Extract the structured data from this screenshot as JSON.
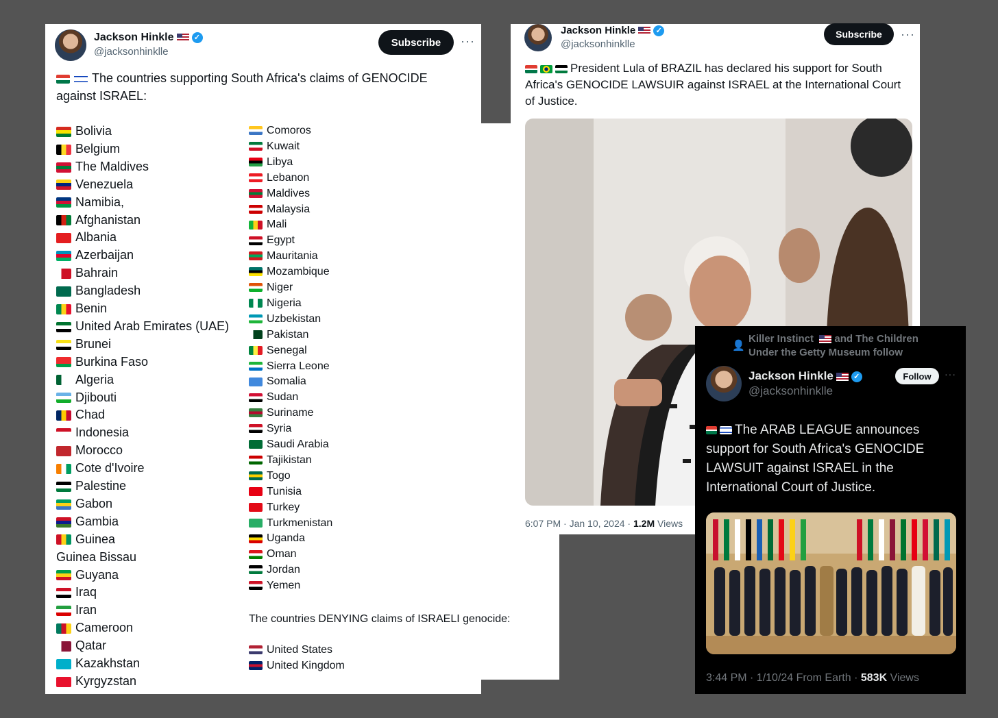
{
  "tweet1": {
    "user": {
      "name": "Jackson Hinkle",
      "handle": "@jacksonhinklle"
    },
    "subscribe_label": "Subscribe",
    "more_label": "···",
    "text_line1": "The countries supporting South Africa's claims of GENOCIDE",
    "text_line2": "against ISRAEL:",
    "col1": [
      {
        "name": "Bolivia",
        "colors": [
          "#d52b1e",
          "#f9e300",
          "#007934"
        ]
      },
      {
        "name": "Belgium",
        "colors": [
          "#000000",
          "#fdda24",
          "#ef3340"
        ],
        "dir": "v"
      },
      {
        "name": "The Maldives",
        "colors": [
          "#d21034",
          "#007e3a",
          "#d21034"
        ]
      },
      {
        "name": "Venezuela",
        "colors": [
          "#fcd116",
          "#00247d",
          "#cf142b"
        ]
      },
      {
        "name": "Namibia,",
        "colors": [
          "#003580",
          "#d21034",
          "#009543"
        ]
      },
      {
        "name": "Afghanistan",
        "colors": [
          "#000000",
          "#d32011",
          "#007a36"
        ],
        "dir": "v"
      },
      {
        "name": "Albania",
        "colors": [
          "#e41e20",
          "#e41e20",
          "#e41e20"
        ]
      },
      {
        "name": "Azerbaijan",
        "colors": [
          "#0092bc",
          "#e4002b",
          "#00af66"
        ]
      },
      {
        "name": "Bahrain",
        "colors": [
          "#ffffff",
          "#ce1126",
          "#ce1126"
        ],
        "dir": "v"
      },
      {
        "name": "Bangladesh",
        "colors": [
          "#006a4e",
          "#006a4e",
          "#006a4e"
        ]
      },
      {
        "name": "Benin",
        "colors": [
          "#008751",
          "#fcd116",
          "#e8112d"
        ],
        "dir": "v"
      },
      {
        "name": "United Arab Emirates (UAE)",
        "colors": [
          "#00732f",
          "#ffffff",
          "#000000"
        ]
      },
      {
        "name": "Brunei",
        "colors": [
          "#f7e017",
          "#ffffff",
          "#000000"
        ]
      },
      {
        "name": "Burkina Faso",
        "colors": [
          "#ef2b2d",
          "#ef2b2d",
          "#009e49"
        ]
      },
      {
        "name": "Algeria",
        "colors": [
          "#006233",
          "#ffffff",
          "#ffffff"
        ],
        "dir": "v"
      },
      {
        "name": "Djibouti",
        "colors": [
          "#6ab2e7",
          "#ffffff",
          "#12ad2b"
        ]
      },
      {
        "name": "Chad",
        "colors": [
          "#002664",
          "#fecb00",
          "#c60c30"
        ],
        "dir": "v"
      },
      {
        "name": "Indonesia",
        "colors": [
          "#ce1126",
          "#ffffff",
          "#ffffff"
        ]
      },
      {
        "name": "Morocco",
        "colors": [
          "#c1272d",
          "#c1272d",
          "#c1272d"
        ]
      },
      {
        "name": "Cote d'Ivoire",
        "colors": [
          "#f77f00",
          "#ffffff",
          "#009e60"
        ],
        "dir": "v"
      },
      {
        "name": "Palestine",
        "colors": [
          "#000000",
          "#ffffff",
          "#007a3d"
        ]
      },
      {
        "name": "Gabon",
        "colors": [
          "#009e60",
          "#fcd116",
          "#3a75c4"
        ]
      },
      {
        "name": "Gambia",
        "colors": [
          "#ce1126",
          "#0c1c8c",
          "#3a7728"
        ]
      },
      {
        "name": "Guinea",
        "colors": [
          "#ce1126",
          "#fcd116",
          "#009460"
        ],
        "dir": "v"
      },
      {
        "name": "Guinea Bissau",
        "noflag": true
      },
      {
        "name": "Guyana",
        "colors": [
          "#009e49",
          "#fcd116",
          "#ce1126"
        ]
      },
      {
        "name": "Iraq",
        "colors": [
          "#ce1126",
          "#ffffff",
          "#000000"
        ]
      },
      {
        "name": "Iran",
        "colors": [
          "#239f40",
          "#ffffff",
          "#da0000"
        ]
      },
      {
        "name": "Cameroon",
        "colors": [
          "#007a5e",
          "#ce1126",
          "#fcd116"
        ],
        "dir": "v"
      },
      {
        "name": "Qatar",
        "colors": [
          "#ffffff",
          "#8a1538",
          "#8a1538"
        ],
        "dir": "v"
      },
      {
        "name": "Kazakhstan",
        "colors": [
          "#00afca",
          "#00afca",
          "#00afca"
        ]
      },
      {
        "name": "Kyrgyzstan",
        "colors": [
          "#e8112d",
          "#e8112d",
          "#e8112d"
        ]
      }
    ],
    "col2": [
      {
        "name": "Comoros",
        "colors": [
          "#ffc61e",
          "#ffffff",
          "#3a75c4"
        ]
      },
      {
        "name": "Kuwait",
        "colors": [
          "#007a3d",
          "#ffffff",
          "#ce1126"
        ]
      },
      {
        "name": "Libya",
        "colors": [
          "#e70013",
          "#000000",
          "#239e46"
        ]
      },
      {
        "name": "Lebanon",
        "colors": [
          "#ed1c24",
          "#ffffff",
          "#ed1c24"
        ]
      },
      {
        "name": "Maldives",
        "colors": [
          "#d21034",
          "#007e3a",
          "#d21034"
        ]
      },
      {
        "name": "Malaysia",
        "colors": [
          "#cc0001",
          "#ffffff",
          "#cc0001"
        ]
      },
      {
        "name": "Mali",
        "colors": [
          "#14b53a",
          "#fcd116",
          "#ce1126"
        ],
        "dir": "v"
      },
      {
        "name": "Egypt",
        "colors": [
          "#ce1126",
          "#ffffff",
          "#000000"
        ]
      },
      {
        "name": "Mauritania",
        "colors": [
          "#d01c1f",
          "#00a95c",
          "#d01c1f"
        ]
      },
      {
        "name": "Mozambique",
        "colors": [
          "#007168",
          "#000000",
          "#fce100"
        ]
      },
      {
        "name": "Niger",
        "colors": [
          "#e05206",
          "#ffffff",
          "#0db02b"
        ]
      },
      {
        "name": "Nigeria",
        "colors": [
          "#008751",
          "#ffffff",
          "#008751"
        ],
        "dir": "v"
      },
      {
        "name": "Uzbekistan",
        "colors": [
          "#0099b5",
          "#ffffff",
          "#1eb53a"
        ]
      },
      {
        "name": "Pakistan",
        "colors": [
          "#ffffff",
          "#01411c",
          "#01411c"
        ],
        "dir": "v"
      },
      {
        "name": "Senegal",
        "colors": [
          "#00853f",
          "#fdef42",
          "#e31b23"
        ],
        "dir": "v"
      },
      {
        "name": "Sierra Leone",
        "colors": [
          "#1eb53a",
          "#ffffff",
          "#0072c6"
        ]
      },
      {
        "name": "Somalia",
        "colors": [
          "#4189dd",
          "#4189dd",
          "#4189dd"
        ]
      },
      {
        "name": "Sudan",
        "colors": [
          "#d21034",
          "#ffffff",
          "#000000"
        ]
      },
      {
        "name": "Suriname",
        "colors": [
          "#377e3f",
          "#b40a2d",
          "#377e3f"
        ]
      },
      {
        "name": "Syria",
        "colors": [
          "#ce1126",
          "#ffffff",
          "#000000"
        ]
      },
      {
        "name": "Saudi Arabia",
        "colors": [
          "#006c35",
          "#006c35",
          "#006c35"
        ]
      },
      {
        "name": "Tajikistan",
        "colors": [
          "#cc0000",
          "#ffffff",
          "#006600"
        ]
      },
      {
        "name": "Togo",
        "colors": [
          "#006a4e",
          "#ffce00",
          "#006a4e"
        ]
      },
      {
        "name": "Tunisia",
        "colors": [
          "#e70013",
          "#e70013",
          "#e70013"
        ]
      },
      {
        "name": "Turkey",
        "colors": [
          "#e30a17",
          "#e30a17",
          "#e30a17"
        ]
      },
      {
        "name": "Turkmenistan",
        "colors": [
          "#28ae66",
          "#28ae66",
          "#28ae66"
        ]
      },
      {
        "name": "Uganda",
        "colors": [
          "#000000",
          "#fcdc04",
          "#d90000"
        ]
      },
      {
        "name": "Oman",
        "colors": [
          "#db161b",
          "#ffffff",
          "#008000"
        ]
      },
      {
        "name": "Jordan",
        "colors": [
          "#000000",
          "#ffffff",
          "#007a3d"
        ]
      },
      {
        "name": "Yemen",
        "colors": [
          "#ce1126",
          "#ffffff",
          "#000000"
        ]
      }
    ],
    "denying_text": "The countries DENYING claims of ISRAELI genocide:",
    "denying": [
      {
        "name": "United States",
        "colors": [
          "#b22234",
          "#ffffff",
          "#3c3b6e"
        ]
      },
      {
        "name": "United Kingdom",
        "colors": [
          "#012169",
          "#c8102e",
          "#012169"
        ]
      }
    ]
  },
  "tweet2": {
    "user": {
      "name": "Jackson Hinkle",
      "handle": "@jacksonhinklle"
    },
    "subscribe_label": "Subscribe",
    "more_label": "···",
    "text_line1": "President Lula of BRAZIL has declared his support for South",
    "text_line2": "Africa's GENOCIDE LAWSUIR against ISRAEL at the International Court",
    "text_line3": "of Justice.",
    "time": "6:07 PM · Jan 10, 2024 · ",
    "views_count": "1.2M",
    "views_label": " Views"
  },
  "tweet3": {
    "social_context_line1": "Killer Instinct",
    "social_context_line1b": "and The Children",
    "social_context_line2": "Under the Getty Museum follow",
    "user": {
      "name": "Jackson Hinkle",
      "handle": "@jacksonhinklle"
    },
    "follow_label": "Follow",
    "more_label": "···",
    "text_line1": "The ARAB LEAGUE announces",
    "text_line2": "support for South Africa's GENOCIDE",
    "text_line3": "LAWSUIT against ISRAEL in the",
    "text_line4": "International Court of Justice.",
    "time": "3:44 PM · 1/10/24 From Earth · ",
    "views_count": "583K",
    "views_label": " Views"
  }
}
